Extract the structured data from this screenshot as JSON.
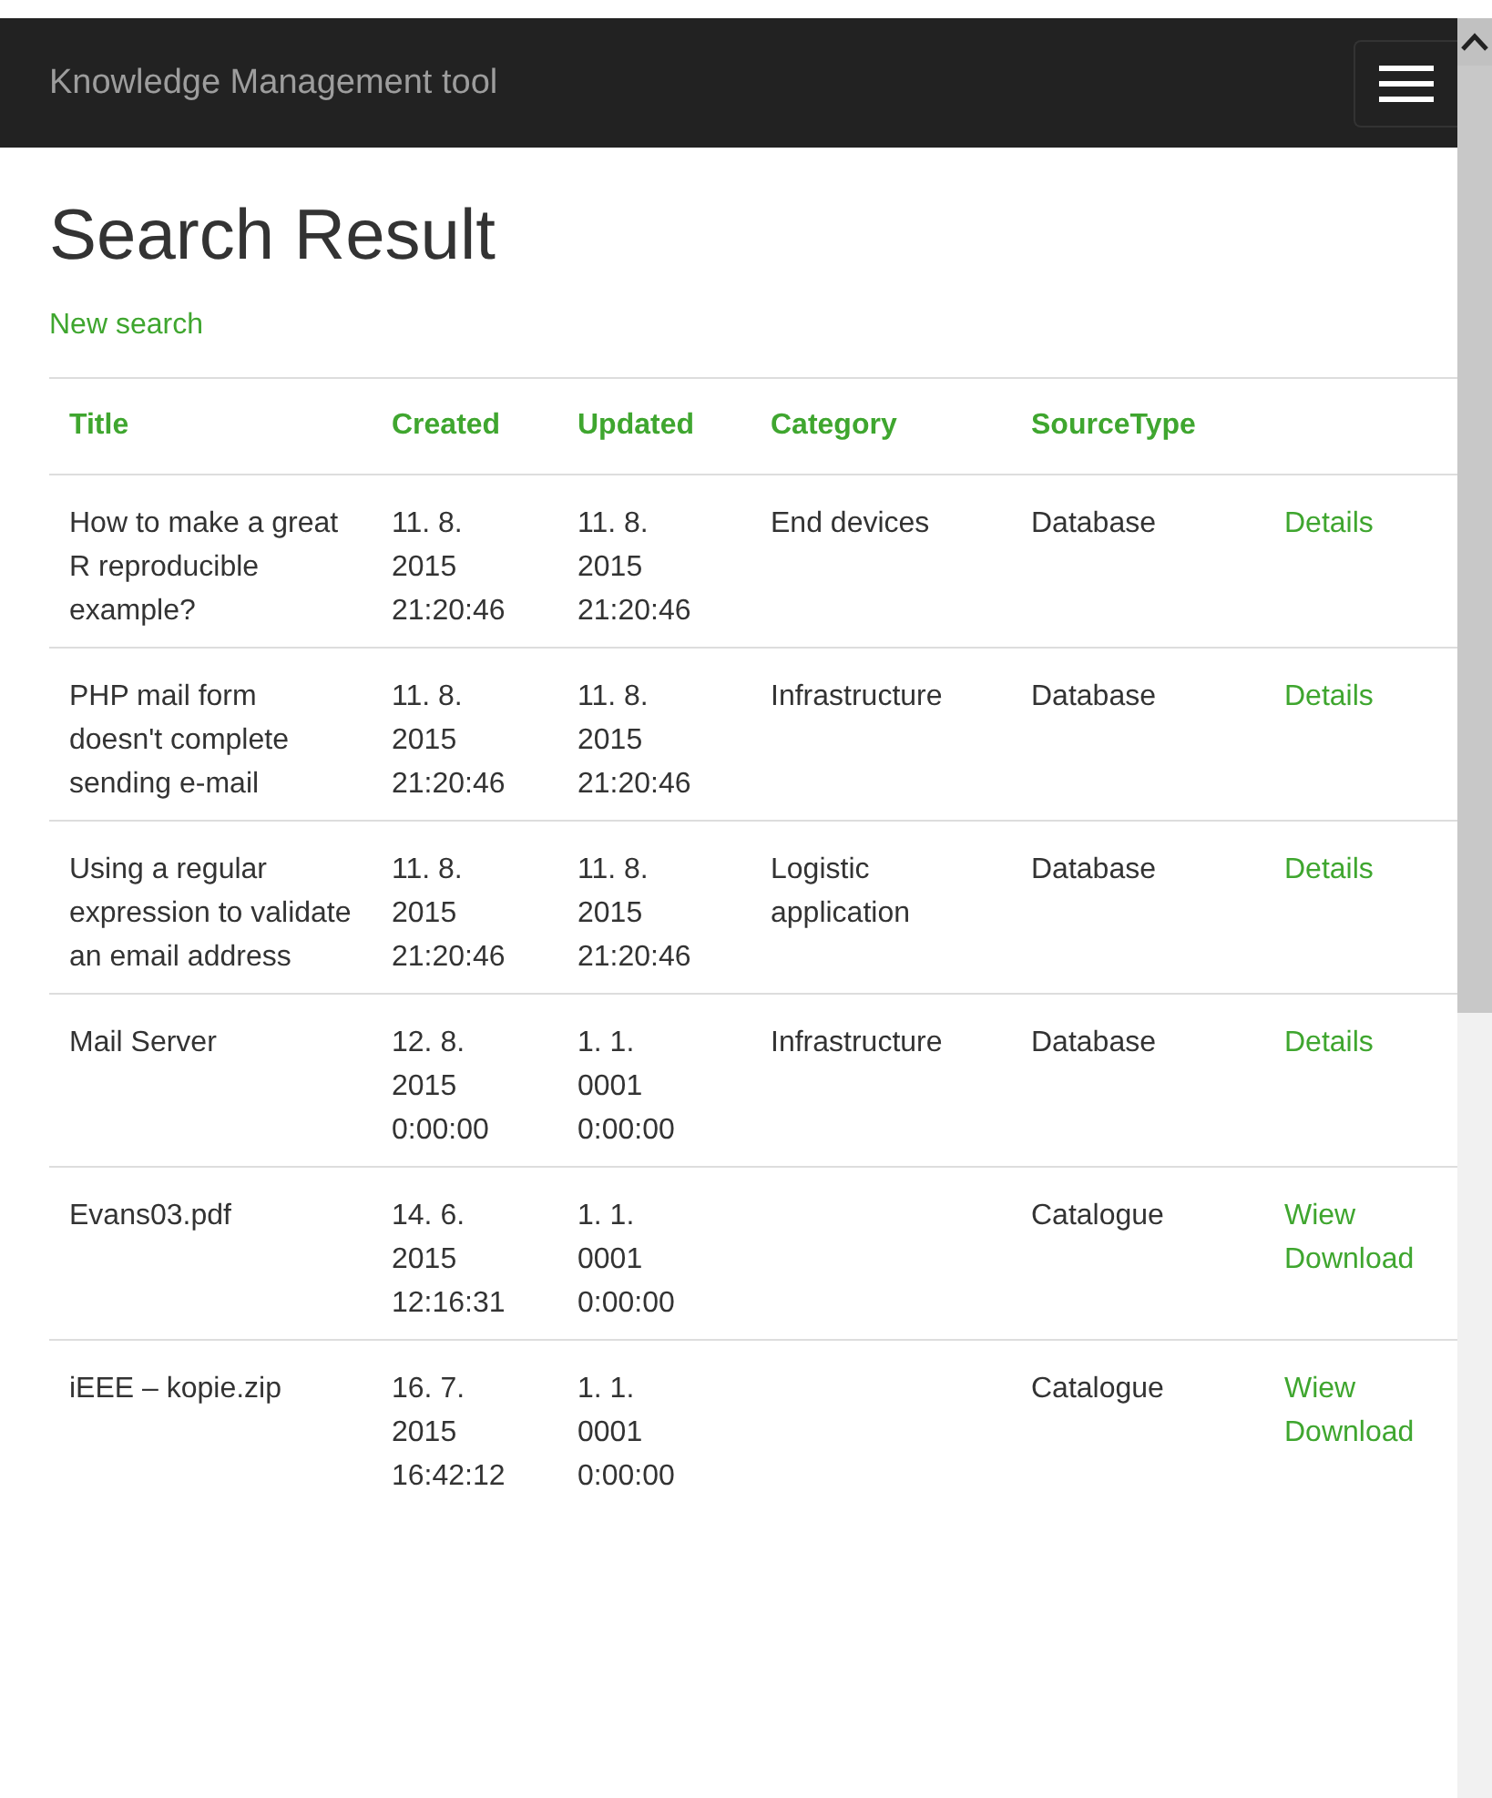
{
  "navbar": {
    "brand": "Knowledge Management tool"
  },
  "heading": "Search Result",
  "new_search_link": "New search",
  "table": {
    "columns": [
      "Title",
      "Created",
      "Updated",
      "Category",
      "SourceType"
    ],
    "rows": [
      {
        "title": "How to make a great R reproducible example?",
        "created": "11. 8.\n2015\n21:20:46",
        "updated": "11. 8.\n2015\n21:20:46",
        "category": "End devices",
        "source_type": "Database",
        "actions": [
          "Details"
        ]
      },
      {
        "title": "PHP mail form doesn't complete sending e-mail",
        "created": "11. 8.\n2015\n21:20:46",
        "updated": "11. 8.\n2015\n21:20:46",
        "category": "Infrastructure",
        "source_type": "Database",
        "actions": [
          "Details"
        ]
      },
      {
        "title": "Using a regular expression to validate an email address",
        "created": "11. 8.\n2015\n21:20:46",
        "updated": "11. 8.\n2015\n21:20:46",
        "category": "Logistic application",
        "source_type": "Database",
        "actions": [
          "Details"
        ]
      },
      {
        "title": "Mail Server",
        "created": "12. 8.\n2015\n0:00:00",
        "updated": "1. 1.\n0001\n0:00:00",
        "category": "Infrastructure",
        "source_type": "Database",
        "actions": [
          "Details"
        ]
      },
      {
        "title": "Evans03.pdf",
        "created": "14. 6.\n2015\n12:16:31",
        "updated": "1. 1.\n0001\n0:00:00",
        "source_type": "Catalogue",
        "actions": [
          "Wiew",
          "Download"
        ]
      },
      {
        "title": "iEEE – kopie.zip",
        "created": "16. 7.\n2015\n16:42:12",
        "updated": "1. 1.\n0001\n0:00:00",
        "source_type": "Catalogue",
        "actions": [
          "Wiew",
          "Download"
        ]
      }
    ]
  }
}
